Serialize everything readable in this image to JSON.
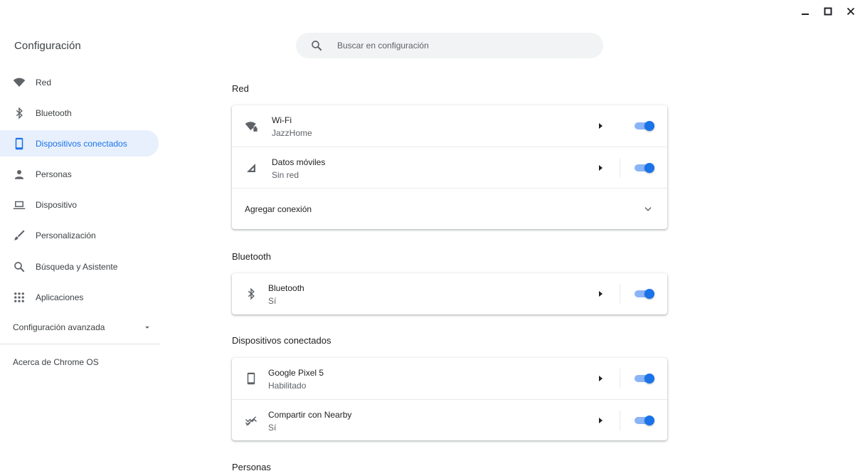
{
  "window": {
    "minimize_icon": "minimize-icon",
    "maximize_icon": "maximize-icon",
    "close_icon": "close-icon"
  },
  "app_title": "Configuración",
  "search": {
    "placeholder": "Buscar en configuración",
    "value": ""
  },
  "sidebar": {
    "items": [
      {
        "label": "Red",
        "icon": "wifi-icon"
      },
      {
        "label": "Bluetooth",
        "icon": "bluetooth-icon"
      },
      {
        "label": "Dispositivos conectados",
        "icon": "phone-icon",
        "active": true
      },
      {
        "label": "Personas",
        "icon": "person-icon"
      },
      {
        "label": "Dispositivo",
        "icon": "laptop-icon"
      },
      {
        "label": "Personalización",
        "icon": "brush-icon"
      },
      {
        "label": "Búsqueda y Asistente",
        "icon": "search-icon"
      },
      {
        "label": "Aplicaciones",
        "icon": "apps-grid-icon"
      }
    ],
    "advanced": "Configuración avanzada",
    "about": "Acerca de Chrome OS"
  },
  "sections": {
    "network": {
      "title": "Red",
      "wifi": {
        "title": "Wi-Fi",
        "subtitle": "JazzHome",
        "enabled": true
      },
      "mobile": {
        "title": "Datos móviles",
        "subtitle": "Sin red",
        "enabled": true
      },
      "add": {
        "label": "Agregar conexión"
      }
    },
    "bluetooth": {
      "title": "Bluetooth",
      "row": {
        "title": "Bluetooth",
        "subtitle": "Sí",
        "enabled": true
      }
    },
    "connected": {
      "title": "Dispositivos conectados",
      "phone": {
        "title": "Google Pixel 5",
        "subtitle": "Habilitado",
        "enabled": true
      },
      "nearby": {
        "title": "Compartir con Nearby",
        "subtitle": "Sí",
        "enabled": true
      }
    },
    "people": {
      "title": "Personas"
    }
  },
  "colors": {
    "accent": "#1a73e8",
    "active_bg": "#e8f0fe",
    "toggle_track": "#8ab4f8"
  }
}
